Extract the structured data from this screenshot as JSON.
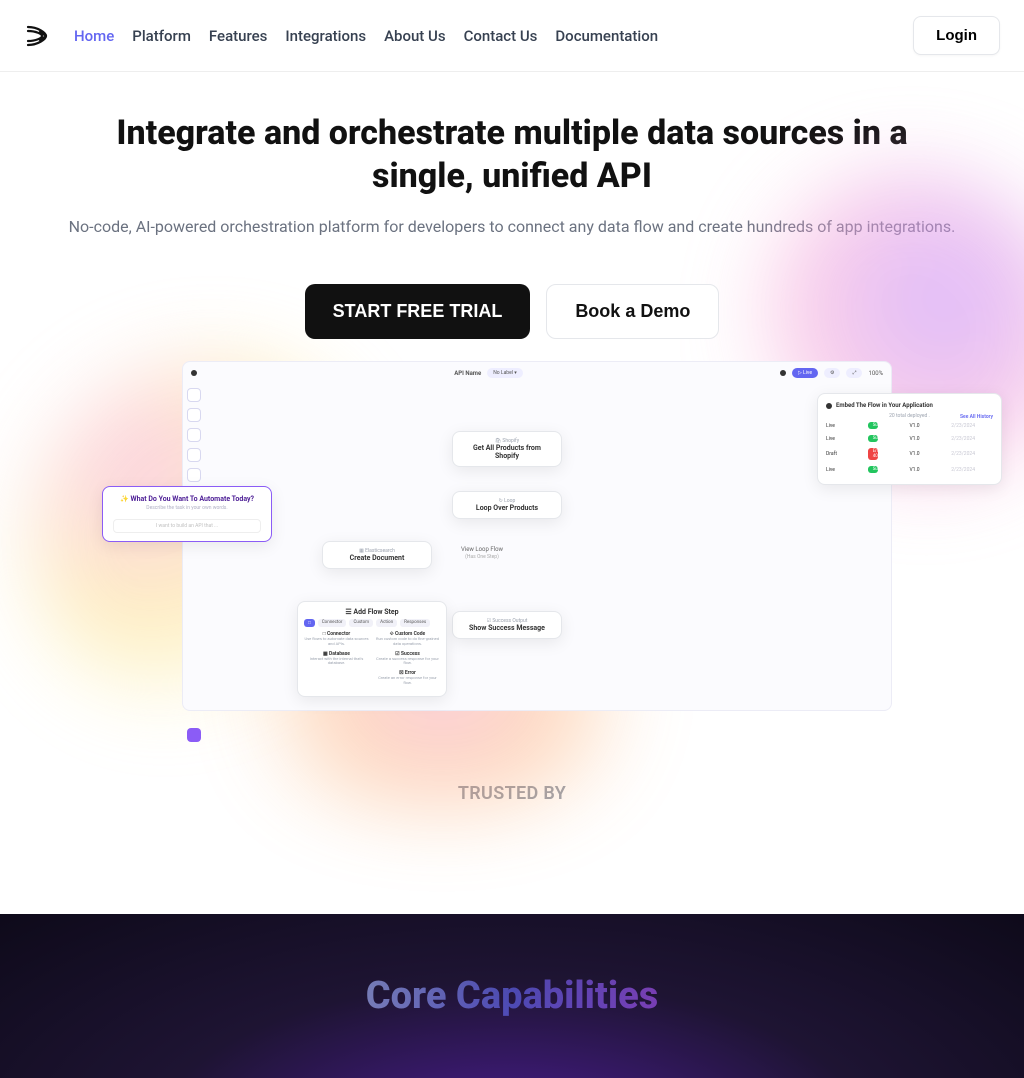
{
  "nav": {
    "links": [
      "Home",
      "Platform",
      "Features",
      "Integrations",
      "About Us",
      "Contact Us",
      "Documentation"
    ],
    "active_index": 0,
    "login": "Login"
  },
  "hero": {
    "title": "Integrate and orchestrate multiple data sources in a single, unified API",
    "subtitle": "No-code, AI-powered orchestration platform for developers to connect any data flow and create hundreds of app integrations.",
    "cta_primary": "START FREE TRIAL",
    "cta_secondary": "Book a Demo"
  },
  "canvas": {
    "api_label": "API Name",
    "no_label": "No Label ▾",
    "live": "▷ Live",
    "zoom": "100%",
    "prompt": {
      "header": "What Do You Want To Automate Today?",
      "hint": "Describe the task in your own words.",
      "placeholder": "I want to build an API that ..."
    },
    "nodes": {
      "shopify_tag": "🛍 Shopify",
      "shopify_title": "Get All Products from Shopify",
      "loop_tag": "↻ Loop",
      "loop_title": "Loop Over Products",
      "elastic_tag": "▦ Elasticsearch",
      "elastic_title": "Create Document",
      "view_label": "View Loop Flow",
      "view_sub": "(Has One Step)",
      "success_tag": "☑ Success Output",
      "success_title": "Show Success Message"
    },
    "add_step": {
      "header": "☰ Add Flow Step",
      "chips": [
        "□",
        "Connector",
        "Custom",
        "Action",
        "Responses"
      ],
      "items_left": [
        {
          "t": "□ Connector",
          "d": "Use flows to automate data sources and APIs."
        },
        {
          "t": "▦ Database",
          "d": "Interact with the internal that's database."
        }
      ],
      "items_right": [
        {
          "t": "⟐ Custom Code",
          "d": "Run custom code to do fine-grained data operations."
        },
        {
          "t": "☑ Success",
          "d": "Create a success response for your flow."
        },
        {
          "t": "☒ Error",
          "d": "Create an error response for your flow."
        }
      ]
    },
    "deploy": {
      "header": "Embed The Flow in Your Application",
      "sub": "20 total deployed .",
      "link": "See All History",
      "rows": [
        {
          "env": "Live",
          "status": "Success",
          "ver": "V1.0",
          "date": "2/23/2024"
        },
        {
          "env": "Live",
          "status": "Success",
          "ver": "V1.0",
          "date": "2/23/2024"
        },
        {
          "env": "Draft",
          "status": "Error 401",
          "ver": "V1.0",
          "date": "2/23/2024"
        },
        {
          "env": "Live",
          "status": "Success",
          "ver": "V1.0",
          "date": "2/23/2024"
        }
      ]
    }
  },
  "trusted": "TRUSTED BY",
  "core_title": "Core Capabilities"
}
